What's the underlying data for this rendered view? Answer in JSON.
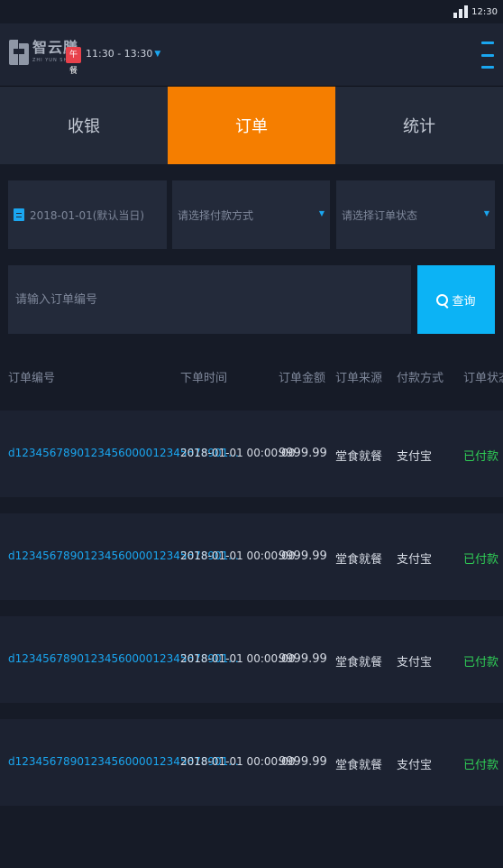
{
  "status_bar": {
    "time": "12:30"
  },
  "header": {
    "logo_name": "智云膳",
    "logo_subtitle": "ZHI YUN SHAN",
    "meal_badge": "午餐",
    "meal_time": "11:30 - 13:30"
  },
  "tabs": [
    {
      "label": "收银",
      "active": false
    },
    {
      "label": "订单",
      "active": true
    },
    {
      "label": "统计",
      "active": false
    }
  ],
  "filters": {
    "date": "2018-01-01(默认当日)",
    "payment_placeholder": "请选择付款方式",
    "status_placeholder": "请选择订单状态"
  },
  "search": {
    "placeholder": "请输入订单编号",
    "button_label": "查询"
  },
  "table": {
    "headers": [
      "订单编号",
      "下单时间",
      "订单金额",
      "订单来源",
      "付款方式",
      "订单状态"
    ],
    "rows": [
      [
        "d1234567890123456000012345678901...",
        "2018-01-01   00:00:00",
        "9999.99",
        "堂食就餐",
        "支付宝",
        "已付款"
      ],
      [
        "d1234567890123456000012345678901...",
        "2018-01-01   00:00:00",
        "9999.99",
        "堂食就餐",
        "支付宝",
        "已付款"
      ],
      [
        "d1234567890123456000012345678901...",
        "2018-01-01   00:00:00",
        "9999.99",
        "堂食就餐",
        "支付宝",
        "已付款"
      ],
      [
        "d1234567890123456000012345678901...",
        "2018-01-01   00:00:00",
        "9999.99",
        "堂食就餐",
        "支付宝",
        "已付款"
      ]
    ]
  },
  "colors": {
    "accent_blue": "#1aa6f0",
    "active_tab": "#f57e00",
    "paid_green": "#2fcb55",
    "meal_badge_red": "#e8414b"
  }
}
